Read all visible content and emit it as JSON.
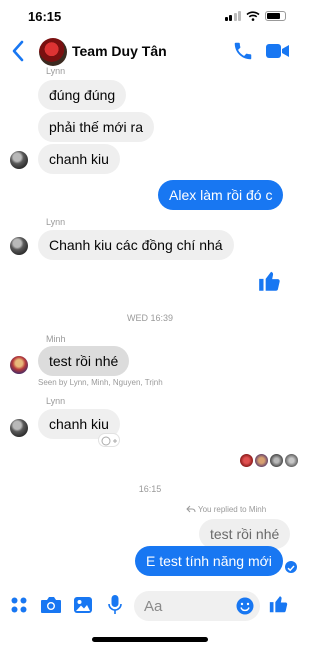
{
  "status_bar": {
    "time": "16:15"
  },
  "header": {
    "title": "Team Duy Tân"
  },
  "colors": {
    "accent": "#1877f2",
    "incoming_bubble": "#efefef",
    "meta_text": "#9a9a9a"
  },
  "icons": {
    "back": "chevron-left-icon",
    "call": "phone-icon",
    "video": "video-camera-icon",
    "like": "thumbs-up-icon",
    "apps": "four-dots-icon",
    "camera": "camera-icon",
    "gallery": "photo-icon",
    "mic": "microphone-icon",
    "emoji": "smiley-icon"
  },
  "messages": {
    "m1": {
      "sender": "Lynn",
      "text": "đúng đúng"
    },
    "m2": {
      "text": "phải thế mới ra"
    },
    "m3": {
      "text": "chanh kiu"
    },
    "m4": {
      "text": "Alex làm rồi đó c"
    },
    "m5": {
      "sender": "Lynn",
      "text": "Chanh kiu các đồng chí nhá"
    },
    "time1": "WED 16:39",
    "m6": {
      "sender": "Minh",
      "text": "test rồi nhé"
    },
    "seen_by": "Seen by Lynn, Minh, Nguyen, Trịnh",
    "m7": {
      "sender": "Lynn",
      "text": "chanh kiu"
    },
    "time2": "16:15",
    "reply_note": "You replied to Minh",
    "quoted": "test rồi nhé",
    "m8": {
      "text": "E test tính năng mới"
    }
  },
  "composer": {
    "placeholder": "Aa"
  }
}
